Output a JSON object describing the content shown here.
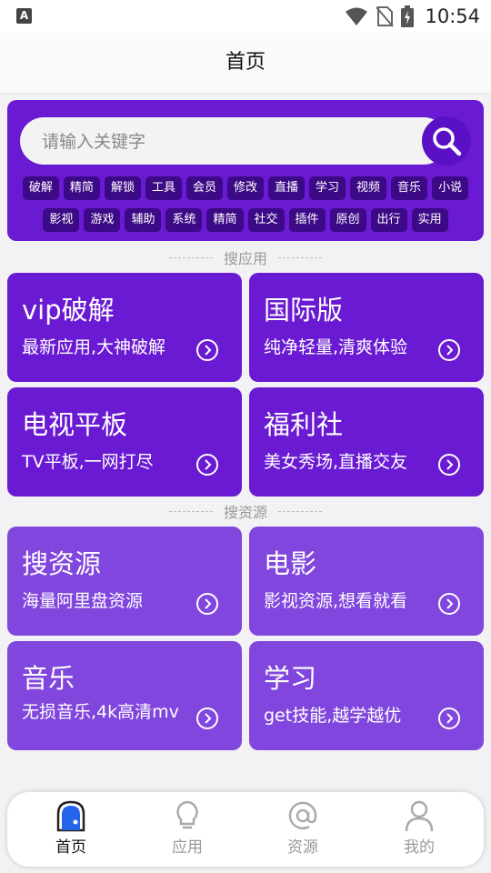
{
  "status_bar": {
    "left_icon": "A",
    "time": "10:54",
    "icons": [
      "wifi-icon",
      "no-sim-icon",
      "battery-charging-icon"
    ]
  },
  "header": {
    "title": "首页"
  },
  "search": {
    "placeholder": "请输入关键字",
    "button_icon": "search-icon",
    "tags_row1": [
      "破解",
      "精简",
      "解锁",
      "工具",
      "会员",
      "修改",
      "直播",
      "学习",
      "视频",
      "音乐",
      "小说"
    ],
    "tags_row2": [
      "影视",
      "游戏",
      "辅助",
      "系统",
      "精简",
      "社交",
      "插件",
      "原创",
      "出行",
      "实用"
    ]
  },
  "sections": [
    {
      "title": "搜应用",
      "cards": [
        {
          "title": "vip破解",
          "desc": "最新应用,大神破解"
        },
        {
          "title": "国际版",
          "desc": "纯净轻量,清爽体验"
        },
        {
          "title": "电视平板",
          "desc": "TV平板,一网打尽"
        },
        {
          "title": "福利社",
          "desc": "美女秀场,直播交友"
        }
      ]
    },
    {
      "title": "搜资源",
      "cards": [
        {
          "title": "搜资源",
          "desc": "海量阿里盘资源"
        },
        {
          "title": "电影",
          "desc": "影视资源,想看就看"
        },
        {
          "title": "音乐",
          "desc": "无损音乐,4k高清mv"
        },
        {
          "title": "学习",
          "desc": "get技能,越学越优"
        }
      ]
    }
  ],
  "colors": {
    "accent_dark": "#6a1ad3",
    "accent_light": "#8046de",
    "tag_bg": "#3c0a86"
  },
  "bottom_nav": [
    {
      "label": "首页",
      "icon": "home-icon",
      "active": true
    },
    {
      "label": "应用",
      "icon": "lightbulb-icon",
      "active": false
    },
    {
      "label": "资源",
      "icon": "at-icon",
      "active": false
    },
    {
      "label": "我的",
      "icon": "user-icon",
      "active": false
    }
  ]
}
